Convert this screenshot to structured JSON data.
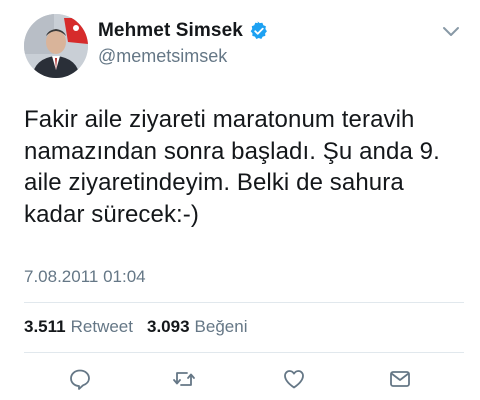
{
  "author": {
    "display_name": "Mehmet Simsek",
    "handle": "@memetsimsek",
    "verified": true,
    "verified_color": "#1da1f2"
  },
  "tweet": {
    "text": "Fakir aile ziyareti maratonum teravih\nnamazından sonra başladı. Şu anda 9.\naile ziyaretindeyim. Belki de sahura\nkadar sürecek:-)",
    "timestamp": "7.08.2011 01:04"
  },
  "stats": {
    "retweets_count": "3.511",
    "retweets_label": "Retweet",
    "likes_count": "3.093",
    "likes_label": "Beğeni"
  },
  "icons": {
    "reply": "reply-icon",
    "retweet": "retweet-icon",
    "like": "like-icon",
    "share": "share-icon",
    "caret": "chevron-down-icon"
  },
  "colors": {
    "text": "#14171a",
    "secondary": "#657786",
    "divider": "#e1e8ed"
  }
}
